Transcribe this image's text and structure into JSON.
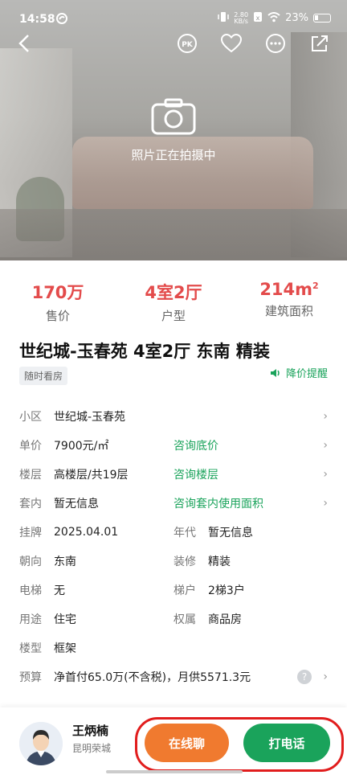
{
  "status": {
    "time": "14:58",
    "net_speed_value": "2.80",
    "net_speed_unit": "KB/s",
    "battery": "23%"
  },
  "hero": {
    "caption": "照片正在拍摄中"
  },
  "stats": [
    {
      "value": "170万",
      "label": "售价"
    },
    {
      "value": "4室2厅",
      "label": "户型"
    },
    {
      "value": "214m",
      "sup": "2",
      "label": "建筑面积"
    }
  ],
  "listing": {
    "title": "世纪城-玉春苑 4室2厅 东南 精装",
    "tag": "随时看房",
    "price_alert": "降价提醒"
  },
  "rows": {
    "community": {
      "k": "小区",
      "v": "世纪城-玉春苑"
    },
    "unit_price": {
      "k": "单价",
      "v": "7900元/㎡",
      "action": "咨询底价"
    },
    "floor": {
      "k": "楼层",
      "v": "高楼层/共19层",
      "action": "咨询楼层"
    },
    "inner": {
      "k": "套内",
      "v": "暂无信息",
      "action": "咨询套内使用面积"
    },
    "listed": {
      "k": "挂牌",
      "v": "2025.04.01",
      "k2": "年代",
      "v2": "暂无信息"
    },
    "orientation": {
      "k": "朝向",
      "v": "东南",
      "k2": "装修",
      "v2": "精装"
    },
    "elevator": {
      "k": "电梯",
      "v": "无",
      "k2": "梯户",
      "v2": "2梯3户"
    },
    "usage": {
      "k": "用途",
      "v": "住宅",
      "k2": "权属",
      "v2": "商品房"
    },
    "building": {
      "k": "楼型",
      "v": "框架"
    },
    "budget": {
      "k": "预算",
      "v": "净首付65.0万(不含税)，月供5571.3元"
    }
  },
  "agent": {
    "name": "王炳楠",
    "company": "昆明荣城"
  },
  "actions": {
    "chat": "在线聊",
    "call": "打电话"
  },
  "colors": {
    "price_red": "#e34b4b",
    "green": "#1aa35b",
    "orange": "#f07a2f",
    "highlight": "#e11d1d"
  }
}
